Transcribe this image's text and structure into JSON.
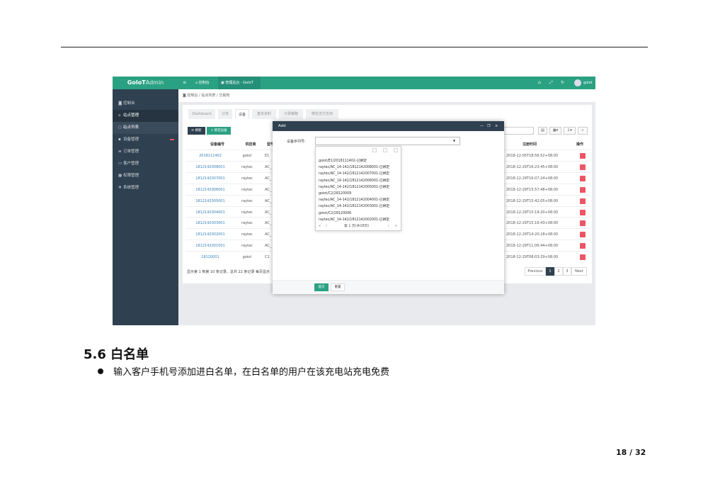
{
  "app": {
    "brand_bold": "GoIoT",
    "brand_light": "Admin",
    "topbar": {
      "menu_icon": "≡",
      "home_tab": "控制台",
      "active_tab": "管理后台 - GoIoT",
      "user": "goiot"
    },
    "sidebar": {
      "items": [
        {
          "icon": "dashboard-icon",
          "glyph": "◙",
          "label": "控制台"
        },
        {
          "icon": "home-icon",
          "glyph": "⌂",
          "label": "站点管理"
        },
        {
          "icon": "circle-icon",
          "glyph": "○",
          "label": "站点列表"
        },
        {
          "icon": "device-icon",
          "glyph": "▪",
          "label": "设备管理"
        },
        {
          "icon": "list-icon",
          "glyph": "≡",
          "label": "订单管理"
        },
        {
          "icon": "card-icon",
          "glyph": "▭",
          "label": "客户管理"
        },
        {
          "icon": "grid-icon",
          "glyph": "▦",
          "label": "权限管理"
        },
        {
          "icon": "cogs-icon",
          "glyph": "✲",
          "label": "系统管理"
        }
      ]
    },
    "breadcrumb": [
      "控制台",
      "站点列表",
      "华晨苑"
    ],
    "subtabs": [
      "Dashboard",
      "订单",
      "设备",
      "基本资料",
      "计费策略",
      "微信支付支持"
    ],
    "toolbar": {
      "refresh_label": "⟳ 刷新",
      "bind_label": "+ 绑定设备"
    },
    "table": {
      "headers": {
        "sn": "设备编号",
        "supplier": "供应商",
        "model": "型号",
        "reg_time": "注册时间",
        "op": "操作"
      },
      "rows": [
        {
          "sn": "2018111402",
          "supplier": "goiot",
          "model": "E1",
          "time": "2018-12-05T18:56:52+08:00"
        },
        {
          "sn": "1812142008001",
          "supplier": "raytec",
          "model": "AC_",
          "time": "2018-12-29T16:23:45+08:00"
        },
        {
          "sn": "1812142007001",
          "supplier": "raytec",
          "model": "AC_",
          "time": "2018-12-29T16:07:24+08:00"
        },
        {
          "sn": "1812142006001",
          "supplier": "raytec",
          "model": "AC_",
          "time": "2018-12-29T15:57:48+08:00"
        },
        {
          "sn": "1812142005001",
          "supplier": "raytec",
          "model": "AC_",
          "time": "2018-12-29T15:42:05+08:00"
        },
        {
          "sn": "1812142004001",
          "supplier": "raytec",
          "model": "AC_",
          "time": "2018-12-29T15:19:20+08:00"
        },
        {
          "sn": "1812142003001",
          "supplier": "raytec",
          "model": "AC_",
          "time": "2018-12-29T15:16:43+08:00"
        },
        {
          "sn": "1812142002001",
          "supplier": "raytec",
          "model": "AC_",
          "time": "2018-12-29T14:20:18+08:00"
        },
        {
          "sn": "1812142001001",
          "supplier": "raytec",
          "model": "AC_",
          "time": "2018-12-29T11:06:44+08:00"
        },
        {
          "sn": "18120001",
          "supplier": "goiot",
          "model": "C1",
          "time": "2018-12-29T08:03:29+08:00"
        }
      ],
      "footer_info": "显示第 1 到第 10 条记录，总共 22 条记录 每页显示",
      "pagination": {
        "prev": "Previous",
        "pages": [
          "1",
          "2",
          "3"
        ],
        "next": "Next"
      }
    },
    "modal": {
      "title": "Add",
      "minimize": "—",
      "restore": "❐",
      "close": "×",
      "field_label": "设备序列号:",
      "options": [
        "goiot/E1/2018111402-已绑定",
        "raytec/AC_14-142/1812142008001-已绑定",
        "raytec/AC_14-142/1812142007001-已绑定",
        "raytec/AC_14-142/1812142006001-已绑定",
        "raytec/AC_14-142/1812142005001-已绑定",
        "goiot/C2/28120009",
        "raytec/AC_14-142/1812142004001-已绑定",
        "raytec/AC_14-142/1812142003001-已绑定",
        "goiot/C2/28120006",
        "raytec/AC_14-142/1812142002001-已绑定"
      ],
      "pager": {
        "first": "«",
        "prev": "‹",
        "text": "第 1 页(共18页)",
        "next": "›",
        "last": "»"
      },
      "submit_label": "提交",
      "reset_label": "重置"
    }
  },
  "doc": {
    "section_title": "5.6 白名单",
    "bullet": "输入客户手机号添加进白名单，在白名单的用户在该充电站充电免费",
    "page_number": "18 / 32"
  }
}
